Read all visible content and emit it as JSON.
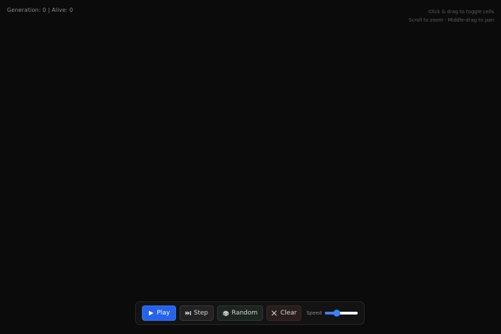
{
  "stats": {
    "text": "Generation: 0 | Alive: 0"
  },
  "hints": {
    "line1": "Click & drag to toggle cells",
    "line2": "Scroll to zoom · Middle-drag to pan"
  },
  "toolbar": {
    "play_label": "Play",
    "play_icon": "play-icon",
    "step_label": "Step",
    "step_icon": "skip-forward-icon",
    "random_label": "Random",
    "random_icon": "dice-icon",
    "clear_label": "Clear",
    "clear_icon": "close-icon",
    "speed_label": "Speed",
    "speed_value": 0.35
  },
  "colors": {
    "background": "#0b0b0b",
    "accent": "#2563eb",
    "slider_fill": "#3b82f6"
  }
}
